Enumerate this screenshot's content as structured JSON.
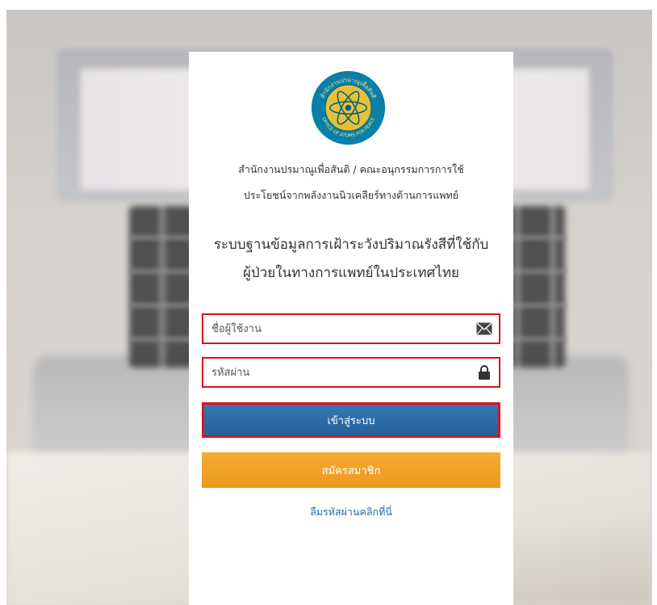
{
  "organization": {
    "line1": "สำนักงานปรมาณูเพื่อสันติ / คณะอนุกรรมการการใช้",
    "line2": "ประโยชน์จากพลังงานนิวเคลียร์ทางด้านการแพทย์"
  },
  "system_title": {
    "line1": "ระบบฐานข้อมูลการเฝ้าระวังปริมาณรังสีที่ใช้กับ",
    "line2": "ผู้ป่วยในทางการแพทย์ในประเทศไทย"
  },
  "login_form": {
    "username_placeholder": "ชื่อผู้ใช้งาน",
    "username_value": "",
    "password_placeholder": "รหัสผ่าน",
    "password_value": "",
    "login_button": "เข้าสู่ระบบ",
    "register_button": "สมัครสมาชิก",
    "forgot_link": "ลืมรหัสผ่านคลิกที่นี่"
  },
  "logo": {
    "arc_text": "สำนักงานปรมาณูเพื่อสันติ",
    "bottom_text": "OFFICE OF ATOMS FOR PEACE"
  },
  "icons": {
    "username": "envelope-icon",
    "password": "lock-icon"
  },
  "colors": {
    "login_button": "#2b6aa6",
    "register_button": "#f0a125",
    "highlight_border": "#d9161c",
    "link": "#2b6aa6",
    "logo_ring": "#0a7fa8",
    "logo_inner": "#e3c13a"
  }
}
